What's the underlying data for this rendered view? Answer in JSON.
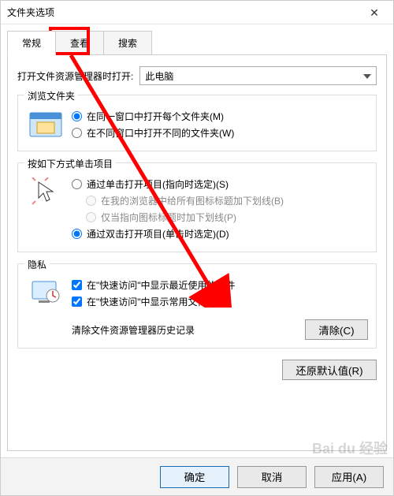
{
  "window": {
    "title": "文件夹选项"
  },
  "tabs": {
    "general": "常规",
    "view": "查看",
    "search": "搜索"
  },
  "openWith": {
    "label": "打开文件资源管理器时打开:",
    "value": "此电脑"
  },
  "browse": {
    "title": "浏览文件夹",
    "same": "在同一窗口中打开每个文件夹(M)",
    "diff": "在不同窗口中打开不同的文件夹(W)"
  },
  "click": {
    "title": "按如下方式单击项目",
    "single": "通过单击打开项目(指向时选定)(S)",
    "sub1": "在我的浏览器中给所有图标标题加下划线(B)",
    "sub2": "仅当指向图标标题时加下划线(P)",
    "double": "通过双击打开项目(单击时选定)(D)"
  },
  "privacy": {
    "title": "隐私",
    "recent": "在\"快速访问\"中显示最近使用的文件",
    "freq": "在\"快速访问\"中显示常用文件夹",
    "clearLabel": "清除文件资源管理器历史记录",
    "clearBtn": "清除(C)"
  },
  "restore": "还原默认值(R)",
  "footer": {
    "ok": "确定",
    "cancel": "取消",
    "apply": "应用(A)"
  },
  "watermark": "Bai du 经验"
}
